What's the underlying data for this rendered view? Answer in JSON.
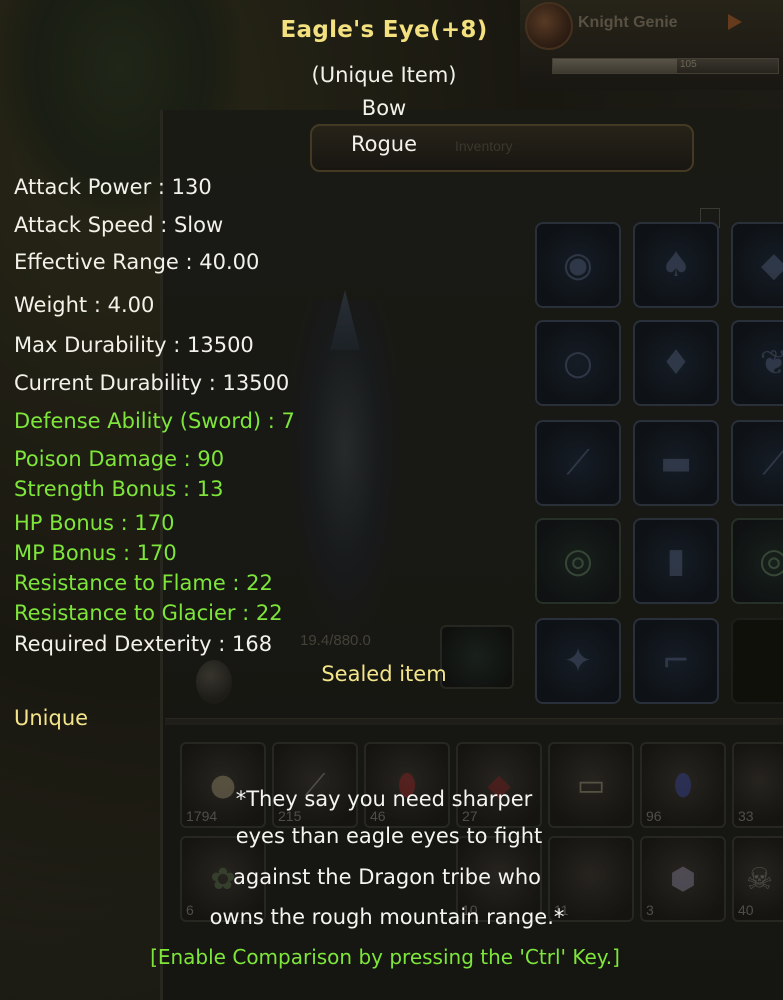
{
  "background": {
    "knight_genie_label": "Knight Genie",
    "knight_genie_value": "105",
    "knight_genie_progress": 0.55,
    "inventory_label": "Inventory",
    "weight_readout": "19.4/880.0",
    "inventory_counts": [
      "1794",
      "215",
      "46",
      "27",
      "96",
      "33",
      "6",
      "10",
      "11",
      "3",
      "40"
    ]
  },
  "tooltip": {
    "item_name": "Eagle's Eye(+8)",
    "rarity": "(Unique Item)",
    "item_type": "Bow",
    "class": "Rogue",
    "stats": [
      {
        "text": "Attack Power : 130",
        "color": "white"
      },
      {
        "text": "Attack Speed : Slow",
        "color": "white"
      },
      {
        "text": "Effective Range : 40.00",
        "color": "white"
      },
      {
        "text": "Weight : 4.00",
        "color": "white"
      },
      {
        "text": "Max Durability : 13500",
        "color": "white"
      },
      {
        "text": "Current Durability : 13500",
        "color": "white"
      },
      {
        "text": "Defense Ability (Sword) : 7",
        "color": "green"
      },
      {
        "text": "Poison Damage : 90",
        "color": "green"
      },
      {
        "text": "Strength Bonus : 13",
        "color": "green"
      },
      {
        "text": "HP Bonus : 170",
        "color": "green"
      },
      {
        "text": "MP Bonus : 170",
        "color": "green"
      },
      {
        "text": "Resistance to Flame : 22",
        "color": "green"
      },
      {
        "text": "Resistance to Glacier : 22",
        "color": "green"
      },
      {
        "text": "Required Dexterity : 168",
        "color": "white"
      }
    ],
    "sealed": "Sealed item",
    "unique_label": "Unique",
    "lore": [
      "*They say you need sharper",
      "eyes than eagle eyes to fight",
      "against the Dragon tribe who",
      "owns the rough mountain range.*"
    ],
    "hint": "[Enable Comparison by pressing the 'Ctrl' Key.]"
  },
  "colors": {
    "title": "#f3e07e",
    "stat_white": "#f2f2ea",
    "stat_green": "#7ee63a",
    "sealed_yellow": "#f3e58a"
  }
}
